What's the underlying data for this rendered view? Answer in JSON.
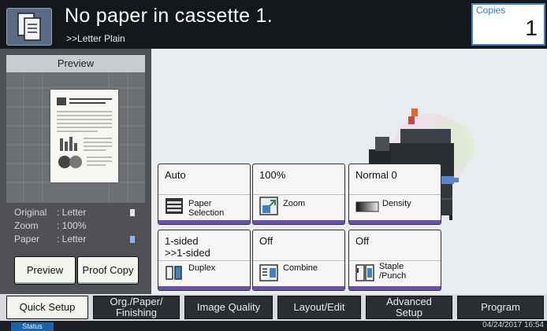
{
  "header": {
    "title": "No paper in cassette 1.",
    "subtitle": ">>Letter  Plain",
    "copies_label": "Copies",
    "copies_value": "1"
  },
  "left_panel": {
    "preview_label": "Preview",
    "info": [
      {
        "key": "Original",
        "value": ": Letter"
      },
      {
        "key": "Zoom",
        "value": ": 100%"
      },
      {
        "key": "Paper",
        "value": ": Letter"
      }
    ],
    "preview_button": "Preview",
    "proof_copy_button": "Proof Copy"
  },
  "functions": [
    {
      "value": "Auto",
      "label": "Paper\nSelection",
      "icon": "paper-tray-icon"
    },
    {
      "value": "100%",
      "label": "Zoom",
      "icon": "zoom-icon"
    },
    {
      "value": "Normal 0",
      "label": "Density",
      "icon": "density-icon"
    },
    {
      "value": "1-sided\n>>1-sided",
      "label": "Duplex",
      "icon": "duplex-icon"
    },
    {
      "value": "Off",
      "label": "Combine",
      "icon": "combine-icon"
    },
    {
      "value": "Off",
      "label": "Staple\n/Punch",
      "icon": "staple-icon"
    }
  ],
  "tabs": [
    {
      "label": "Quick Setup",
      "active": true
    },
    {
      "label": "Org./Paper/\nFinishing",
      "active": false
    },
    {
      "label": "Image Quality",
      "active": false
    },
    {
      "label": "Layout/Edit",
      "active": false
    },
    {
      "label": "Advanced\nSetup",
      "active": false
    },
    {
      "label": "Program",
      "active": false
    }
  ],
  "status": {
    "status_button": "Status",
    "datetime": "04/24/2017 16:54"
  },
  "colors": {
    "header_bg": "#15181b",
    "accent_blue": "#3d82c5",
    "function_bar": "#6a4fb0"
  }
}
